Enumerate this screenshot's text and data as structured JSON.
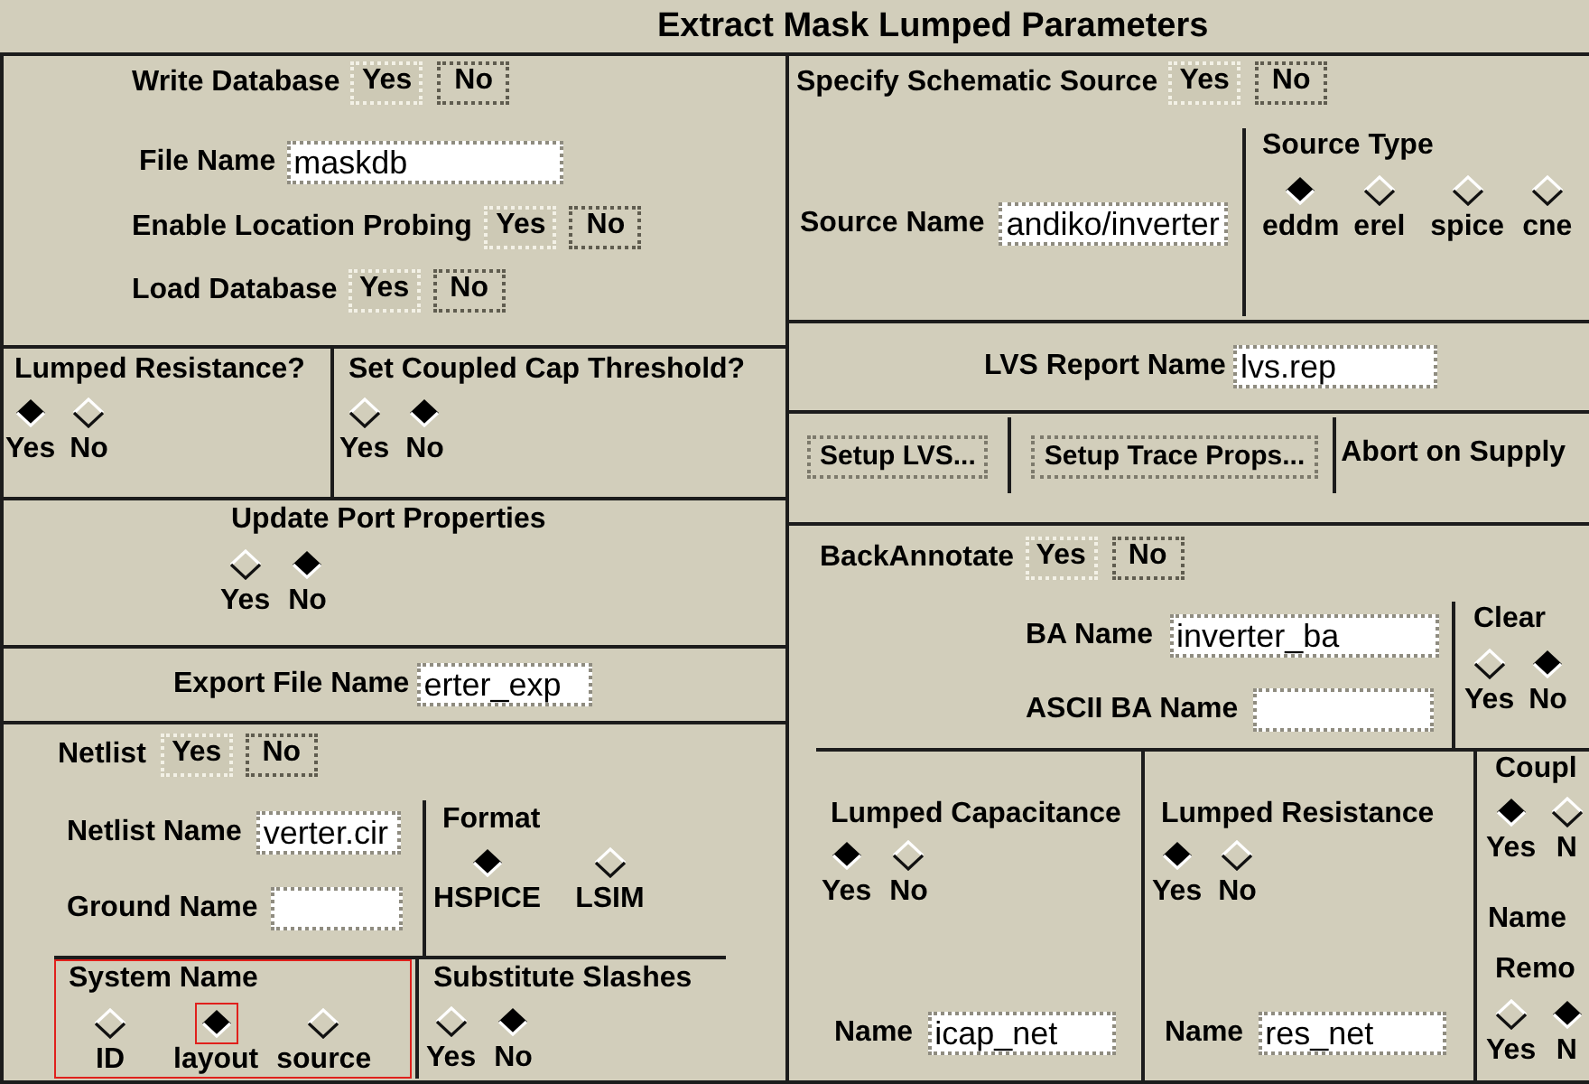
{
  "window": {
    "title": "Extract Mask Lumped Parameters"
  },
  "left_panel": {
    "write_database": {
      "label": "Write Database",
      "options": [
        {
          "label": "Yes",
          "selected": true
        },
        {
          "label": "No",
          "selected": false
        }
      ]
    },
    "file_name": {
      "label": "File Name",
      "value": "maskdb"
    },
    "enable_location_probing": {
      "label": "Enable Location Probing",
      "options": [
        {
          "label": "Yes",
          "selected": true
        },
        {
          "label": "No",
          "selected": false
        }
      ]
    },
    "load_database": {
      "label": "Load Database",
      "options": [
        {
          "label": "Yes",
          "selected": true
        },
        {
          "label": "No",
          "selected": false
        }
      ]
    },
    "lumped_resistance": {
      "label": "Lumped Resistance?",
      "options": [
        {
          "label": "Yes",
          "selected": true
        },
        {
          "label": "No",
          "selected": false
        }
      ]
    },
    "coupled_cap_threshold": {
      "label": "Set Coupled Cap Threshold?",
      "options": [
        {
          "label": "Yes",
          "selected": false
        },
        {
          "label": "No",
          "selected": true
        }
      ]
    },
    "update_port_properties": {
      "label": "Update Port Properties",
      "options": [
        {
          "label": "Yes",
          "selected": false
        },
        {
          "label": "No",
          "selected": true
        }
      ]
    },
    "export_file_name": {
      "label": "Export File Name",
      "value": "erter_exp"
    },
    "netlist": {
      "label": "Netlist",
      "options": [
        {
          "label": "Yes",
          "selected": true
        },
        {
          "label": "No",
          "selected": false
        }
      ]
    },
    "netlist_name": {
      "label": "Netlist Name",
      "value": "verter.cir"
    },
    "ground_name": {
      "label": "Ground Name"
    },
    "format": {
      "label": "Format",
      "options": [
        {
          "label": "HSPICE",
          "selected": true
        },
        {
          "label": "LSIM",
          "selected": false
        }
      ]
    },
    "system_name": {
      "label": "System Name",
      "focused": true,
      "options": [
        {
          "label": "ID",
          "selected": false,
          "focused": false
        },
        {
          "label": "layout",
          "selected": true,
          "focused": true
        },
        {
          "label": "source",
          "selected": false,
          "focused": false
        }
      ]
    },
    "substitute_slashes": {
      "label": "Substitute Slashes",
      "options": [
        {
          "label": "Yes",
          "selected": false
        },
        {
          "label": "No",
          "selected": true
        }
      ]
    }
  },
  "right_panel": {
    "specify_schematic_source": {
      "label": "Specify Schematic Source",
      "options": [
        {
          "label": "Yes",
          "selected": true
        },
        {
          "label": "No",
          "selected": false
        }
      ]
    },
    "source_name": {
      "label": "Source Name",
      "value": "andiko/inverter"
    },
    "source_type": {
      "label": "Source Type",
      "options": [
        {
          "label": "eddm",
          "selected": true
        },
        {
          "label": "erel",
          "selected": false
        },
        {
          "label": "spice",
          "selected": false
        },
        {
          "label": "cne",
          "selected": false
        }
      ]
    },
    "lvs_report_name": {
      "label": "LVS Report Name",
      "value": "lvs.rep"
    },
    "actions_row": [
      {
        "kind": "button",
        "label": "Setup LVS..."
      },
      {
        "kind": "button",
        "label": "Setup Trace Props..."
      },
      {
        "kind": "label",
        "label": "Abort on Supply"
      }
    ],
    "back_annotate": {
      "label": "BackAnnotate",
      "options": [
        {
          "label": "Yes",
          "selected": true
        },
        {
          "label": "No",
          "selected": false
        }
      ]
    },
    "ba_name": {
      "label": "BA Name",
      "value": "inverter_ba"
    },
    "ascii_ba_name": {
      "label": "ASCII BA Name"
    },
    "clear": {
      "label": "Clear",
      "options": [
        {
          "label": "Yes",
          "selected": false
        },
        {
          "label": "No",
          "selected": true
        }
      ]
    },
    "lumped_capacitance": {
      "label": "Lumped Capacitance",
      "options": [
        {
          "label": "Yes",
          "selected": true
        },
        {
          "label": "No",
          "selected": false
        }
      ],
      "name": {
        "label": "Name",
        "value": "icap_net"
      }
    },
    "lumped_resistance": {
      "label": "Lumped Resistance",
      "options": [
        {
          "label": "Yes",
          "selected": true
        },
        {
          "label": "No",
          "selected": false
        }
      ],
      "name": {
        "label": "Name",
        "value": "res_net"
      }
    },
    "group_3": {
      "label": "Coupl",
      "options": [
        {
          "label": "Yes",
          "selected": true
        },
        {
          "label": "N",
          "selected": false
        }
      ],
      "field_label": "Name",
      "subgroup": {
        "label": "Remo",
        "options": [
          {
            "label": "Yes",
            "selected": false
          },
          {
            "label": "N",
            "selected": true
          }
        ]
      }
    }
  }
}
